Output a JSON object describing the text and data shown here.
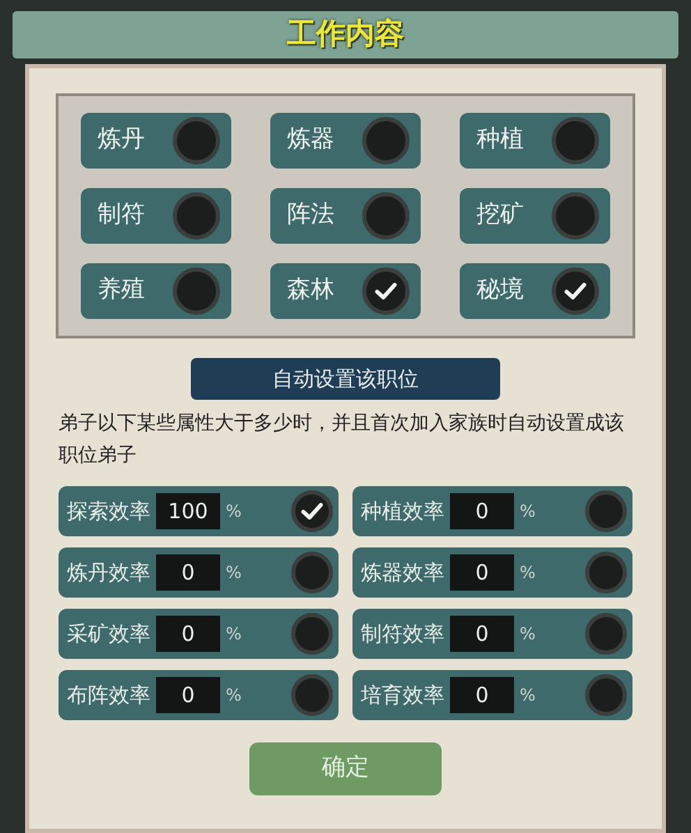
{
  "title": "工作内容",
  "jobs": [
    {
      "label": "炼丹",
      "checked": false
    },
    {
      "label": "炼器",
      "checked": false
    },
    {
      "label": "种植",
      "checked": false
    },
    {
      "label": "制符",
      "checked": false
    },
    {
      "label": "阵法",
      "checked": false
    },
    {
      "label": "挖矿",
      "checked": false
    },
    {
      "label": "养殖",
      "checked": false
    },
    {
      "label": "森林",
      "checked": true
    },
    {
      "label": "秘境",
      "checked": true
    }
  ],
  "section_title": "自动设置该职位",
  "description": "弟子以下某些属性大于多少时，并且首次加入家族时自动设置成该职位弟子",
  "attributes": [
    {
      "label": "探索效率",
      "value": "100",
      "unit": "%",
      "checked": true
    },
    {
      "label": "种植效率",
      "value": "0",
      "unit": "%",
      "checked": false
    },
    {
      "label": "炼丹效率",
      "value": "0",
      "unit": "%",
      "checked": false
    },
    {
      "label": "炼器效率",
      "value": "0",
      "unit": "%",
      "checked": false
    },
    {
      "label": "采矿效率",
      "value": "0",
      "unit": "%",
      "checked": false
    },
    {
      "label": "制符效率",
      "value": "0",
      "unit": "%",
      "checked": false
    },
    {
      "label": "布阵效率",
      "value": "0",
      "unit": "%",
      "checked": false
    },
    {
      "label": "培育效率",
      "value": "0",
      "unit": "%",
      "checked": false
    }
  ],
  "confirm_button": "确定"
}
